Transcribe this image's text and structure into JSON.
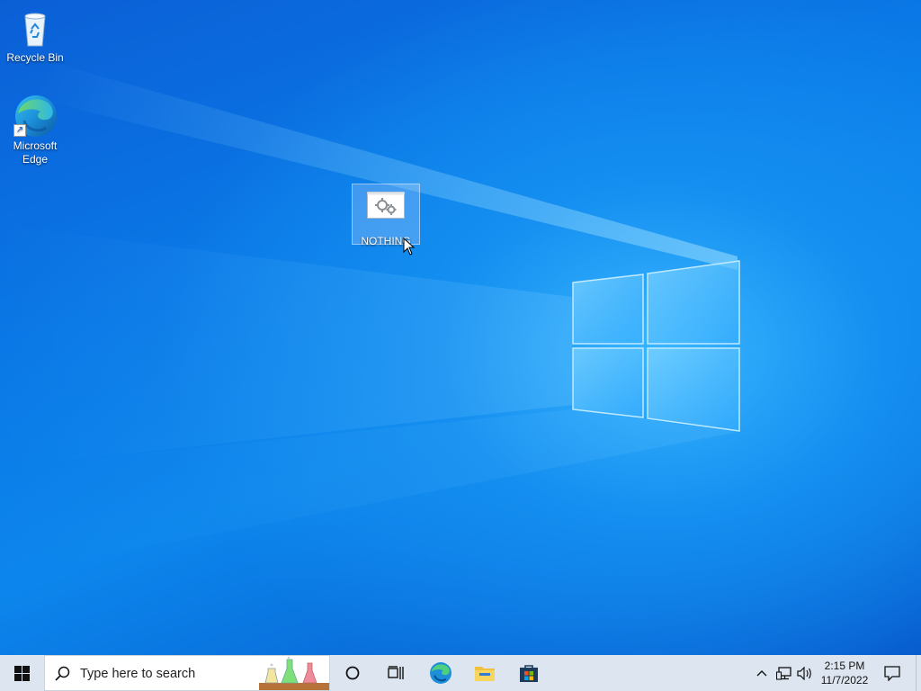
{
  "desktop": {
    "icons": [
      {
        "label": "Recycle Bin",
        "icon": "recycle-bin-icon"
      },
      {
        "label": "Microsoft Edge",
        "icon": "edge-icon",
        "shortcut": true
      },
      {
        "label": "NOTHING",
        "icon": "settings-gears-icon",
        "selected": true
      }
    ],
    "wallpaper": "windows-logo-light-beams"
  },
  "taskbar": {
    "start_icon": "windows-start-icon",
    "search_placeholder": "Type here to search",
    "search_icon": "search-icon",
    "search_highlight": "lab-flasks-icon",
    "pinned": [
      {
        "name": "cortana",
        "icon": "cortana-circle-icon"
      },
      {
        "name": "task-view",
        "icon": "task-view-icon"
      },
      {
        "name": "edge",
        "icon": "edge-icon"
      },
      {
        "name": "file-explorer",
        "icon": "folder-icon"
      },
      {
        "name": "microsoft-store",
        "icon": "store-icon"
      }
    ],
    "tray": {
      "time": "2:15 PM",
      "date": "11/7/2022",
      "icons": [
        "chevron-up-icon",
        "network-icon",
        "volume-icon",
        "notification-icon"
      ]
    }
  },
  "colors": {
    "desktop_blue": "#0a78e6",
    "taskbar_bg": "#dde6f0",
    "accent": "#0078d7"
  }
}
